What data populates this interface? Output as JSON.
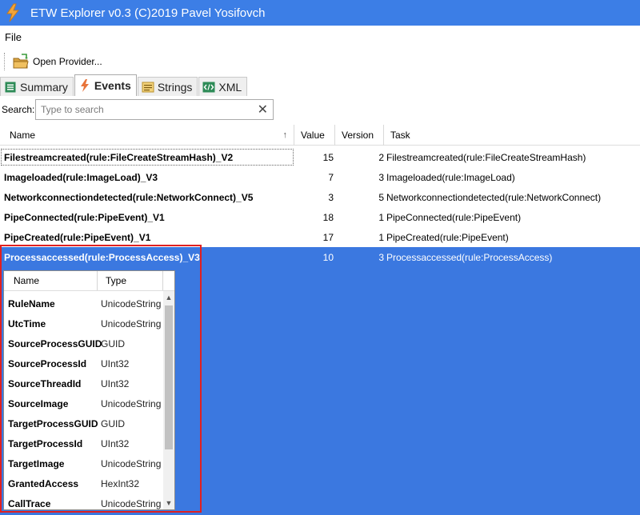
{
  "window": {
    "title": "ETW Explorer v0.3 (C)2019 Pavel Yosifovch"
  },
  "menu": {
    "file_label": "File"
  },
  "toolbar": {
    "open_provider_label": "Open Provider..."
  },
  "tabs": [
    {
      "label": "Summary",
      "icon": "list-icon",
      "active": false
    },
    {
      "label": "Events",
      "icon": "lightning-icon",
      "active": true
    },
    {
      "label": "Strings",
      "icon": "strings-icon",
      "active": false
    },
    {
      "label": "XML",
      "icon": "xml-icon",
      "active": false
    }
  ],
  "search": {
    "label": "Search:",
    "placeholder": "Type to search"
  },
  "events_table": {
    "columns": [
      "Name",
      "Value",
      "Version",
      "Task"
    ],
    "sorted_column": "Name",
    "rows": [
      {
        "name": "Filestreamcreated(rule:FileCreateStreamHash)_V2",
        "value": "15",
        "version": "2",
        "task": "Filestreamcreated(rule:FileCreateStreamHash)"
      },
      {
        "name": "Imageloaded(rule:ImageLoad)_V3",
        "value": "7",
        "version": "3",
        "task": "Imageloaded(rule:ImageLoad)"
      },
      {
        "name": "Networkconnectiondetected(rule:NetworkConnect)_V5",
        "value": "3",
        "version": "5",
        "task": "Networkconnectiondetected(rule:NetworkConnect)"
      },
      {
        "name": "PipeConnected(rule:PipeEvent)_V1",
        "value": "18",
        "version": "1",
        "task": "PipeConnected(rule:PipeEvent)"
      },
      {
        "name": "PipeCreated(rule:PipeEvent)_V1",
        "value": "17",
        "version": "1",
        "task": "PipeCreated(rule:PipeEvent)"
      },
      {
        "name": "Processaccessed(rule:ProcessAccess)_V3",
        "value": "10",
        "version": "3",
        "task": "Processaccessed(rule:ProcessAccess)"
      }
    ]
  },
  "details_table": {
    "columns": [
      "Name",
      "Type"
    ],
    "rows": [
      {
        "name": "RuleName",
        "type": "UnicodeString"
      },
      {
        "name": "UtcTime",
        "type": "UnicodeString"
      },
      {
        "name": "SourceProcessGUID",
        "type": "GUID"
      },
      {
        "name": "SourceProcessId",
        "type": "UInt32"
      },
      {
        "name": "SourceThreadId",
        "type": "UInt32"
      },
      {
        "name": "SourceImage",
        "type": "UnicodeString"
      },
      {
        "name": "TargetProcessGUID",
        "type": "GUID"
      },
      {
        "name": "TargetProcessId",
        "type": "UInt32"
      },
      {
        "name": "TargetImage",
        "type": "UnicodeString"
      },
      {
        "name": "GrantedAccess",
        "type": "HexInt32"
      },
      {
        "name": "CallTrace",
        "type": "UnicodeString"
      }
    ]
  },
  "colors": {
    "titlebar": "#3c7ee6",
    "selection": "#3b78e0",
    "highlight_border": "#e02020"
  }
}
